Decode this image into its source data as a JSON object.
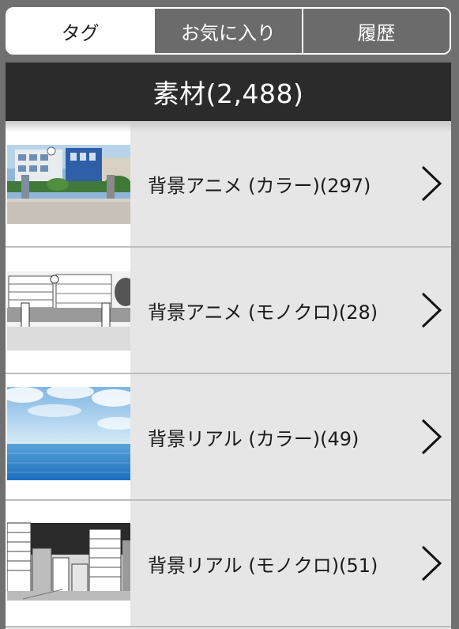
{
  "tabs": [
    {
      "label": "タグ",
      "active": true
    },
    {
      "label": "お気に入り",
      "active": false
    },
    {
      "label": "履歴",
      "active": false
    }
  ],
  "header": {
    "title": "素材(2,488)"
  },
  "items": [
    {
      "label": "背景アニメ (カラー)(297)",
      "thumbnail": "school-color-image"
    },
    {
      "label": "背景アニメ (モノクロ)(28)",
      "thumbnail": "school-mono-image"
    },
    {
      "label": "背景リアル (カラー)(49)",
      "thumbnail": "sea-sky-image"
    },
    {
      "label": "背景リアル (モノクロ)(51)",
      "thumbnail": "city-mono-image"
    }
  ],
  "colors": {
    "header_bg": "#2b2b2b",
    "list_bg": "#e6e6e6",
    "tab_inactive": "#6b6b6b",
    "accent": "#ffffff"
  }
}
